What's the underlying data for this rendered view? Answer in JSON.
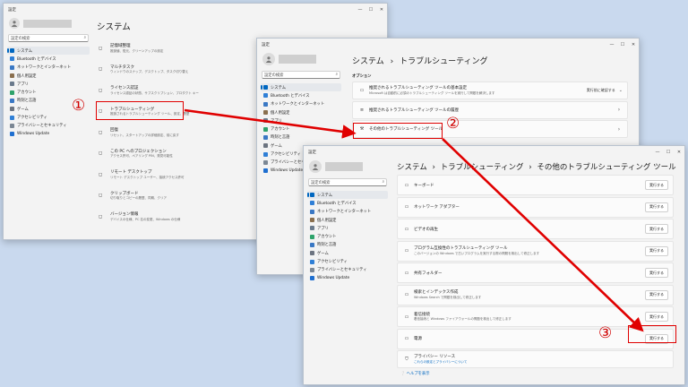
{
  "window_controls": [
    "—",
    "☐",
    "✕"
  ],
  "win1": {
    "title": "設定",
    "search_placeholder": "設定の検索",
    "nav": [
      {
        "label": "システム",
        "icon": "system-icon",
        "color": "#0067c0",
        "active": true
      },
      {
        "label": "Bluetooth とデバイス",
        "icon": "bluetooth-icon",
        "color": "#2f7fd6"
      },
      {
        "label": "ネットワークとインターネット",
        "icon": "network-icon",
        "color": "#3a78c4"
      },
      {
        "label": "個人用設定",
        "icon": "personalization-icon",
        "color": "#8a6f4e"
      },
      {
        "label": "アプリ",
        "icon": "apps-icon",
        "color": "#6a7a8c"
      },
      {
        "label": "アカウント",
        "icon": "accounts-icon",
        "color": "#2ea36b"
      },
      {
        "label": "時刻と言語",
        "icon": "time-language-icon",
        "color": "#3a78c4"
      },
      {
        "label": "ゲーム",
        "icon": "gaming-icon",
        "color": "#6c7480"
      },
      {
        "label": "アクセシビリティ",
        "icon": "accessibility-icon",
        "color": "#2f7fd6"
      },
      {
        "label": "プライバシーとセキュリティ",
        "icon": "privacy-icon",
        "color": "#7b8794"
      },
      {
        "label": "Windows Update",
        "icon": "windows-update-icon",
        "color": "#1f6fd0"
      }
    ],
    "page_title": "システム",
    "items": [
      {
        "title": "記憶域整理",
        "desc": "推奨値、復元、クリーンアップの設定",
        "icon": "storage-icon"
      },
      {
        "title": "マルチタスク",
        "desc": "ウィンドウのスナップ、デスクトップ、タスク切り替え",
        "icon": "multitask-icon"
      },
      {
        "title": "ライセンス認証",
        "desc": "ライセンス認証の状態、サブスクリプション、プロダクト キー",
        "icon": "activation-icon"
      },
      {
        "title": "トラブルシューティング",
        "desc": "推奨されるトラブルシューティング ツール、設定、履歴",
        "icon": "troubleshoot-icon"
      },
      {
        "title": "回復",
        "desc": "リセット、スタートアップの詳細設定、前に戻す",
        "icon": "recovery-icon"
      },
      {
        "title": "この PC へのプロジェクション",
        "desc": "アクセス許可、ペアリング PIN、発見可能性",
        "icon": "projection-icon"
      },
      {
        "title": "リモート デスクトップ",
        "desc": "リモート デスクトップ ユーザー、接続アクセス許可",
        "icon": "remote-desktop-icon"
      },
      {
        "title": "クリップボード",
        "desc": "切り取りとコピーの履歴、同期、クリア",
        "icon": "clipboard-icon"
      },
      {
        "title": "バージョン情報",
        "desc": "デバイスの仕様、PC 名の変更、Windows の仕様",
        "icon": "info-icon"
      }
    ]
  },
  "win2": {
    "title": "設定",
    "search_placeholder": "設定の検索",
    "nav": [
      {
        "label": "システム",
        "icon": "system-icon",
        "color": "#0067c0",
        "active": true
      },
      {
        "label": "Bluetooth とデバイス",
        "icon": "bluetooth-icon",
        "color": "#2f7fd6"
      },
      {
        "label": "ネットワークとインターネット",
        "icon": "network-icon",
        "color": "#3a78c4"
      },
      {
        "label": "個人用設定",
        "icon": "personalization-icon",
        "color": "#8a6f4e"
      },
      {
        "label": "アプリ",
        "icon": "apps-icon",
        "color": "#6a7a8c"
      },
      {
        "label": "アカウント",
        "icon": "accounts-icon",
        "color": "#2ea36b"
      },
      {
        "label": "時刻と言語",
        "icon": "time-language-icon",
        "color": "#3a78c4"
      },
      {
        "label": "ゲーム",
        "icon": "gaming-icon",
        "color": "#6c7480"
      },
      {
        "label": "アクセシビリティ",
        "icon": "accessibility-icon",
        "color": "#2f7fd6"
      },
      {
        "label": "プライバシーとセキュリティ",
        "icon": "privacy-icon",
        "color": "#7b8794"
      },
      {
        "label": "Windows Update",
        "icon": "windows-update-icon",
        "color": "#1f6fd0"
      }
    ],
    "breadcrumb": [
      "システム",
      "トラブルシューティング"
    ],
    "breadcrumb_sep": "›",
    "section_label": "オプション",
    "option1": {
      "title": "推奨されるトラブルシューティング ツールの基本設定",
      "desc": "Microsoft は自動的に必須のトラブルシューティング ツールを実行して問題を解決します",
      "dropdown": "実行前に確認する",
      "icon": "chat-icon"
    },
    "option2": {
      "title": "推奨されるトラブルシューティング ツールの履歴",
      "icon": "history-icon"
    },
    "option3": {
      "title": "その他のトラブルシューティング ツール",
      "icon": "wrench-icon"
    }
  },
  "win3": {
    "title": "設定",
    "search_placeholder": "設定の検索",
    "nav": [
      {
        "label": "システム",
        "icon": "system-icon",
        "color": "#0067c0",
        "active": true
      },
      {
        "label": "Bluetooth とデバイス",
        "icon": "bluetooth-icon",
        "color": "#2f7fd6"
      },
      {
        "label": "ネットワークとインターネット",
        "icon": "network-icon",
        "color": "#3a78c4"
      },
      {
        "label": "個人用設定",
        "icon": "personalization-icon",
        "color": "#8a6f4e"
      },
      {
        "label": "アプリ",
        "icon": "apps-icon",
        "color": "#6a7a8c"
      },
      {
        "label": "アカウント",
        "icon": "accounts-icon",
        "color": "#2ea36b"
      },
      {
        "label": "時刻と言語",
        "icon": "time-language-icon",
        "color": "#3a78c4"
      },
      {
        "label": "ゲーム",
        "icon": "gaming-icon",
        "color": "#6c7480"
      },
      {
        "label": "アクセシビリティ",
        "icon": "accessibility-icon",
        "color": "#2f7fd6"
      },
      {
        "label": "プライバシーとセキュリティ",
        "icon": "privacy-icon",
        "color": "#7b8794"
      },
      {
        "label": "Windows Update",
        "icon": "windows-update-icon",
        "color": "#1f6fd0"
      }
    ],
    "breadcrumb": [
      "システム",
      "トラブルシューティング",
      "その他のトラブルシューティング ツール"
    ],
    "breadcrumb_sep": "›",
    "run_label": "実行する",
    "tools": [
      {
        "title": "キーボード",
        "desc": "",
        "icon": "keyboard-icon"
      },
      {
        "title": "ネットワーク アダプター",
        "desc": "",
        "icon": "network-adapter-icon"
      },
      {
        "title": "ビデオの再生",
        "desc": "",
        "icon": "video-icon"
      },
      {
        "title": "プログラム互換性のトラブルシューティング ツール",
        "desc": "このバージョンの Windows で古いプログラムを実行する際の問題を検出して修正します",
        "icon": "compat-icon"
      },
      {
        "title": "共有フォルダー",
        "desc": "",
        "icon": "shared-folder-icon"
      },
      {
        "title": "検索とインデックス作成",
        "desc": "Windows Search で問題を検出して修正します",
        "icon": "search-index-icon"
      },
      {
        "title": "着信接続",
        "desc": "着信接続と Windows ファイアウォールの問題を検出して修正します",
        "icon": "incoming-icon"
      },
      {
        "title": "電源",
        "desc": "",
        "icon": "battery-icon"
      }
    ],
    "privacy_title": "プライバシー リソース",
    "privacy_link": "これらの設定とプライバシーについて",
    "help_link": "ヘルプを表示"
  },
  "callouts": [
    "①",
    "②",
    "③"
  ],
  "highlight_color": "#e00000"
}
